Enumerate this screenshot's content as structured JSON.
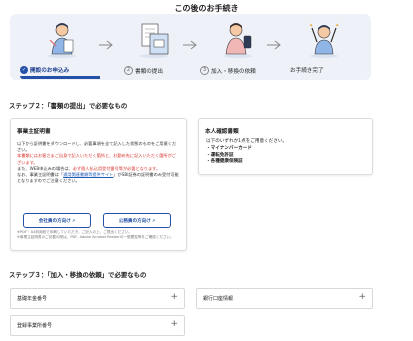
{
  "header": {
    "title": "この後のお手続き"
  },
  "steps": [
    {
      "label": "開設のお申込み",
      "marker": "✓",
      "active": true
    },
    {
      "label": "書類の提出",
      "marker": "2",
      "active": false
    },
    {
      "label": "加入・移換の依頼",
      "marker": "3",
      "active": false
    },
    {
      "label": "お手続き完了",
      "marker": "",
      "active": false
    }
  ],
  "step2": {
    "title": "ステップ２：「書類の提出」で必要なもの",
    "cert_card": {
      "title": "事業主証明書",
      "p1": "以下から証明書をダウンロードし、必要事項を全て記入した状態のものをご用意ください。",
      "p2_red": "本書類にはお客さまご自身で記入いただく箇所と、お勤め先に記入いただく箇所がございます。",
      "p3a": "また、WEB申込みの場合は、",
      "p3_red": "必ず個人払込用受付番号等が必要となります。",
      "p4a": "なお、事業主証明書は「",
      "p4_link": "通用関連書類等提供サイト",
      "p4b": "」がSBI証券の証明書のみ受付可能となりますのでご注意ください。",
      "btn_employee": "会社員の方向け",
      "btn_civil": "公務員の方向け",
      "ext_icon": "↗",
      "note1": "※PDF・A4判用紙で印刷していただき、ご記入の上、ご提出ください。",
      "note2": "※事業主証明書のご記載の際は、PDF, Adobe Acrobat Readerの一般閲覧等をご確認ください。"
    },
    "id_card": {
      "title": "本人確認書類",
      "intro": "以下のいずれか1点をご用意ください。",
      "items": [
        "マイナンバーカード",
        "運転免許証",
        "各種健康保険証"
      ]
    }
  },
  "step3": {
    "title": "ステップ３：「加入・移換の依頼」で必要なもの",
    "items": [
      "基礎年金番号",
      "銀行口座情報",
      "登録事業所番号"
    ],
    "plus_icon": "+"
  },
  "colors": {
    "accent": "#2450a8",
    "warning": "#d8342b",
    "panel": "#eef2f8"
  }
}
